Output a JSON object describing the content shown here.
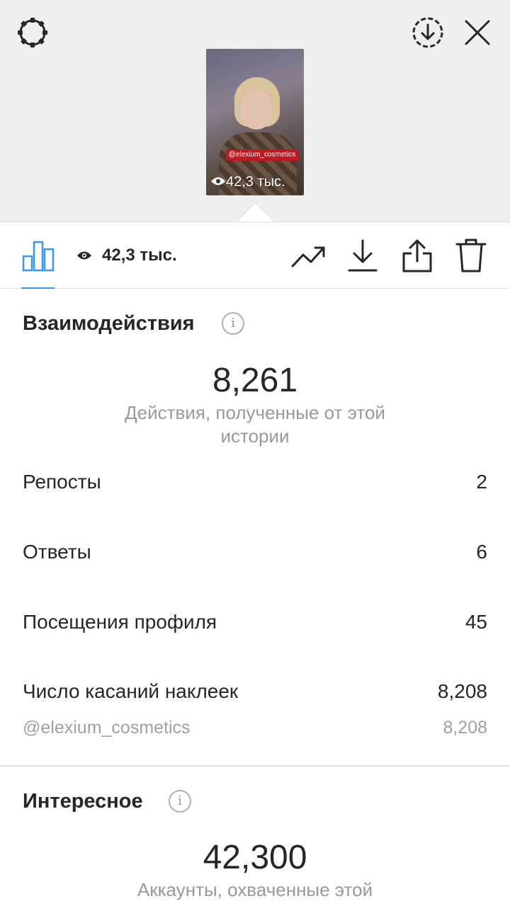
{
  "header": {
    "thumbnail": {
      "sticker_tag": "@elexium_cosmetics",
      "views": "42,3 тыс."
    }
  },
  "toolbar": {
    "views": "42,3 тыс."
  },
  "interactions": {
    "title": "Взаимодействия",
    "total": "8,261",
    "subtitle": "Действия, полученные от этой истории",
    "rows": [
      {
        "label": "Репосты",
        "value": "2"
      },
      {
        "label": "Ответы",
        "value": "6"
      },
      {
        "label": "Посещения профиля",
        "value": "45"
      },
      {
        "label": "Число касаний наклеек",
        "value": "8,208"
      }
    ],
    "sub_row": {
      "label": "@elexium_cosmetics",
      "value": "8,208"
    }
  },
  "discovery": {
    "title": "Интересное",
    "total": "42,300",
    "subtitle": "Аккаунты, охваченные этой"
  },
  "colors": {
    "accent": "#3897f0",
    "top_background": "#efefef",
    "sticker_red": "#c0181e"
  },
  "icons": [
    "settings-gear-icon",
    "download-circle-icon",
    "close-icon",
    "bar-chart-icon",
    "eye-icon",
    "trending-icon",
    "download-icon",
    "share-icon",
    "trash-icon",
    "info-icon"
  ]
}
